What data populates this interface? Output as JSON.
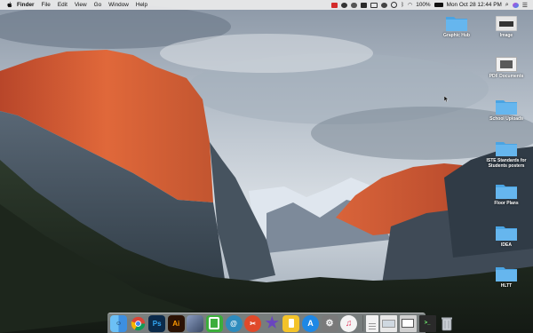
{
  "menubar": {
    "apple_icon": "apple-logo-icon",
    "items": [
      "Finder",
      "File",
      "Edit",
      "View",
      "Go",
      "Window",
      "Help"
    ],
    "battery_percent": "100%",
    "datetime": "Mon Oct 28  12:44 PM",
    "status_icons": [
      "adobe-cc-icon",
      "mirroring-icon",
      "cloud-icon",
      "chrome-extension-icon",
      "display-icon",
      "sync-icon",
      "timemachine-icon",
      "bluetooth-icon",
      "wifi-icon",
      "battery-icon",
      "search-icon",
      "siri-icon",
      "notification-center-icon"
    ]
  },
  "desktop": {
    "icons": [
      {
        "label": "Graphic Hub",
        "kind": "folder"
      },
      {
        "label": "Image",
        "kind": "image"
      },
      {
        "label": "PDF Documents",
        "kind": "image"
      },
      {
        "label": "School Uploads",
        "kind": "folder"
      },
      {
        "label": "ISTE Standards for Students posters",
        "kind": "folder"
      },
      {
        "label": "Floor Plans",
        "kind": "folder"
      },
      {
        "label": "IDEA",
        "kind": "folder"
      },
      {
        "label": "HLTT",
        "kind": "folder"
      }
    ]
  },
  "dock": {
    "apps": [
      {
        "name": "finder-icon",
        "label": "",
        "color": "#3d8fe0"
      },
      {
        "name": "chrome-icon",
        "label": "",
        "color": "#ffffff"
      },
      {
        "name": "photoshop-icon",
        "label": "Ps",
        "color": "#0b2a4a"
      },
      {
        "name": "illustrator-icon",
        "label": "Ai",
        "color": "#2b1204"
      },
      {
        "name": "photos-app-icon",
        "label": "",
        "color": "#5a6b8a"
      },
      {
        "name": "greenscreen-app-icon",
        "label": "",
        "color": "#3cae3c"
      },
      {
        "name": "at-mail-icon",
        "label": "@",
        "color": "#2e8bbd"
      },
      {
        "name": "remote-desktop-icon",
        "label": "",
        "color": "#e04a2a"
      },
      {
        "name": "imovie-star-icon",
        "label": "",
        "color": "#5b3ea8"
      },
      {
        "name": "keynote-icon",
        "label": "",
        "color": "#f3c32a"
      },
      {
        "name": "app-store-icon",
        "label": "",
        "color": "#1e88e5"
      },
      {
        "name": "system-preferences-icon",
        "label": "",
        "color": "#7a7a7a"
      },
      {
        "name": "itunes-icon",
        "label": "",
        "color": "#f4f4f4"
      },
      {
        "name": "document-icon",
        "label": "",
        "color": "#f2f2f2"
      },
      {
        "name": "screenshot-thumb-icon",
        "label": "",
        "color": "#e8e8e8"
      },
      {
        "name": "window-thumb-icon",
        "label": "",
        "color": "#d0d0d0"
      },
      {
        "name": "terminal-thumb-icon",
        "label": "",
        "color": "#2a2a2a"
      },
      {
        "name": "trash-icon",
        "label": "",
        "color": "#bfc5cc"
      }
    ]
  }
}
